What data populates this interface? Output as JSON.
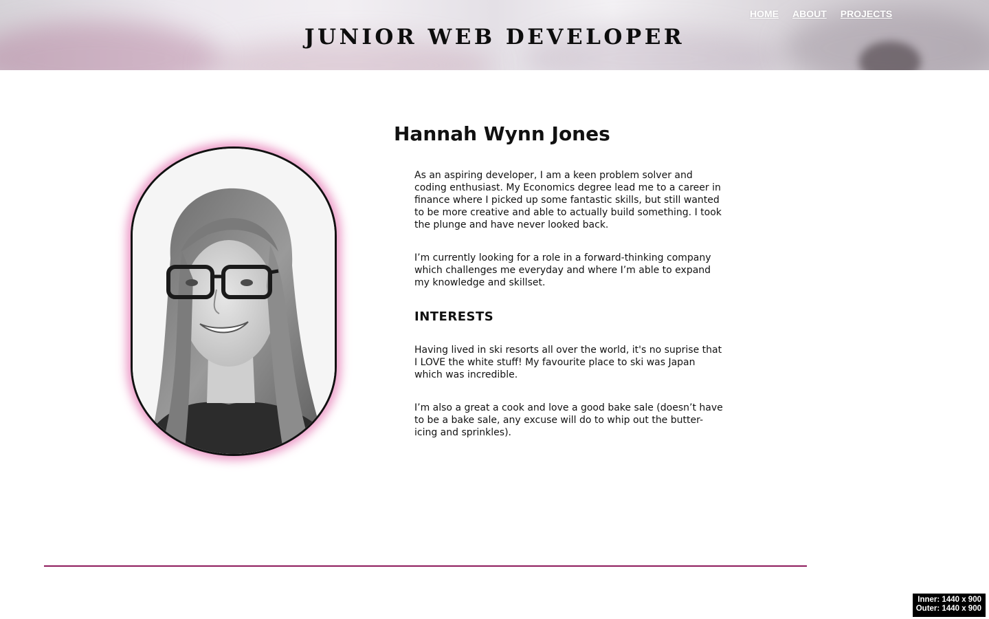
{
  "header": {
    "title": "JUNIOR WEB DEVELOPER",
    "nav": [
      {
        "label": "HOME"
      },
      {
        "label": "ABOUT"
      },
      {
        "label": "PROJECTS"
      }
    ]
  },
  "profile": {
    "name": "Hannah Wynn Jones",
    "photo_icon": "portrait-photo",
    "paragraphs": [
      "As an aspiring developer, I am a keen problem solver and coding enthusiast. My Economics degree lead me to a career in finance where I picked up some fantastic skills, but still wanted to be more creative and able to actually build something. I took the plunge and have never looked back.",
      "I’m currently looking for a role in a forward-thinking company which challenges me everyday and where I’m able to expand my knowledge and skillset."
    ],
    "interests_heading": "INTERESTS",
    "interests": [
      "Having lived in ski resorts all over the world, it's no suprise that I LOVE the white stuff! My favourite place to ski was Japan which was incredible.",
      "I’m also a great a cook and love a good bake sale (doesn’t have to be a bake sale, any excuse will do to whip out the butter-icing and sprinkles)."
    ]
  },
  "viewport": {
    "inner": "Inner: 1440 x 900",
    "outer": "Outer: 1440 x 900"
  },
  "colors": {
    "accent": "#8e1a5c",
    "glow": "#e678b4",
    "text": "#111111"
  }
}
